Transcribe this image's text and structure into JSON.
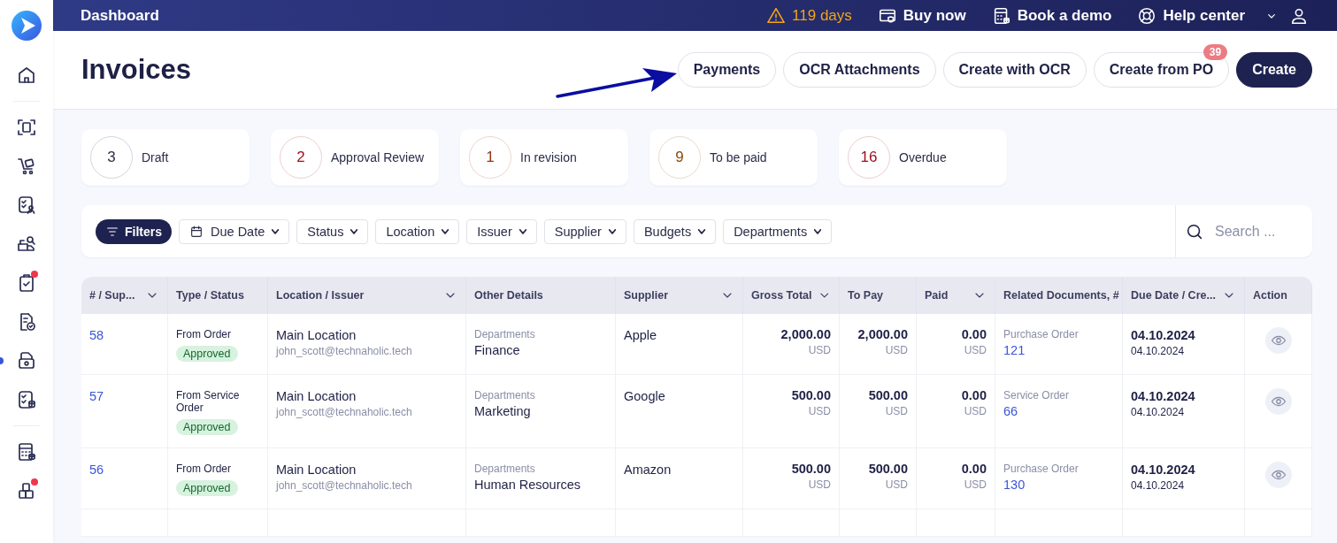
{
  "sidebar": {
    "items": [
      {
        "selected": false,
        "alert": false
      },
      {
        "selected": false,
        "alert": false
      },
      {
        "selected": false,
        "alert": false
      },
      {
        "selected": false,
        "alert": false
      },
      {
        "selected": false,
        "alert": false
      },
      {
        "selected": false,
        "alert": true
      },
      {
        "selected": false,
        "alert": false
      },
      {
        "selected": true,
        "alert": false
      },
      {
        "selected": false,
        "alert": false
      },
      {
        "selected": false,
        "alert": false
      },
      {
        "selected": false,
        "alert": true
      }
    ]
  },
  "topbar": {
    "title": "Dashboard",
    "trial": "119 days",
    "links": [
      "Buy now",
      "Book a demo",
      "Help center"
    ]
  },
  "header": {
    "title": "Invoices",
    "buttons": [
      {
        "label": "Payments",
        "kind": "outline"
      },
      {
        "label": "OCR Attachments",
        "kind": "outline"
      },
      {
        "label": "Create with OCR",
        "kind": "outline"
      },
      {
        "label": "Create from PO",
        "kind": "outline",
        "badge": "39"
      },
      {
        "label": "Create",
        "kind": "primary"
      }
    ]
  },
  "stats": [
    {
      "count": "3",
      "label": "Draft",
      "color": "#2e3048"
    },
    {
      "count": "2",
      "label": "Approval Review",
      "color": "#a3101f"
    },
    {
      "count": "1",
      "label": "In revision",
      "color": "#9a3412"
    },
    {
      "count": "9",
      "label": "To be paid",
      "color": "#8a4a0a"
    },
    {
      "count": "16",
      "label": "Overdue",
      "color": "#9b0b1b"
    }
  ],
  "filters": {
    "main": "Filters",
    "dropdowns": [
      {
        "label": "Due Date",
        "kind": "date"
      },
      {
        "label": "Status",
        "kind": "plain"
      },
      {
        "label": "Location",
        "kind": "plain"
      },
      {
        "label": "Issuer",
        "kind": "plain"
      },
      {
        "label": "Supplier",
        "kind": "plain"
      },
      {
        "label": "Budgets",
        "kind": "plain"
      },
      {
        "label": "Departments",
        "kind": "plain"
      }
    ],
    "search": {
      "placeholder": "Search ..."
    }
  },
  "table": {
    "columns": [
      {
        "label": "# / Sup...",
        "sortable": true
      },
      {
        "label": "Type / Status",
        "sortable": false
      },
      {
        "label": "Location / Issuer",
        "sortable": true
      },
      {
        "label": "Other Details",
        "sortable": false
      },
      {
        "label": "Supplier",
        "sortable": true
      },
      {
        "label": "Gross Total",
        "sortable": true
      },
      {
        "label": "To Pay",
        "sortable": false
      },
      {
        "label": "Paid",
        "sortable": true
      },
      {
        "label": "Related Documents, #",
        "sortable": false
      },
      {
        "label": "Due Date / Cre...",
        "sortable": true
      },
      {
        "label": "Action",
        "sortable": false
      }
    ],
    "rows": [
      {
        "number": "58",
        "type": "From Order",
        "status": "Approved",
        "location": "Main Location",
        "issuer": "john_scott@technaholic.tech",
        "detail_label": "Departments",
        "detail_value": "Finance",
        "supplier": "Apple",
        "gross": "2,000.00",
        "gross_currency": "USD",
        "to_pay": "2,000.00",
        "to_pay_currency": "USD",
        "paid": "0.00",
        "paid_currency": "USD",
        "doc_type": "Purchase Order",
        "doc_number": "121",
        "due_date": "04.10.2024",
        "created_date": "04.10.2024"
      },
      {
        "number": "57",
        "type": "From Service Order",
        "status": "Approved",
        "location": "Main Location",
        "issuer": "john_scott@technaholic.tech",
        "detail_label": "Departments",
        "detail_value": "Marketing",
        "supplier": "Google",
        "gross": "500.00",
        "gross_currency": "USD",
        "to_pay": "500.00",
        "to_pay_currency": "USD",
        "paid": "0.00",
        "paid_currency": "USD",
        "doc_type": "Service Order",
        "doc_number": "66",
        "due_date": "04.10.2024",
        "created_date": "04.10.2024"
      },
      {
        "number": "56",
        "type": "From Order",
        "status": "Approved",
        "location": "Main Location",
        "issuer": "john_scott@technaholic.tech",
        "detail_label": "Departments",
        "detail_value": "Human Resources",
        "supplier": "Amazon",
        "gross": "500.00",
        "gross_currency": "USD",
        "to_pay": "500.00",
        "to_pay_currency": "USD",
        "paid": "0.00",
        "paid_currency": "USD",
        "doc_type": "Purchase Order",
        "doc_number": "130",
        "due_date": "04.10.2024",
        "created_date": "04.10.2024"
      }
    ]
  }
}
